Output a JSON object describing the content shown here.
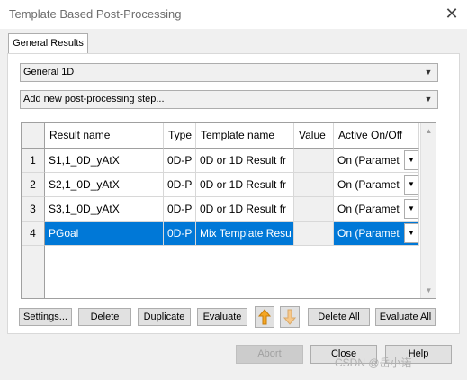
{
  "window": {
    "title": "Template Based Post-Processing"
  },
  "tabs": [
    {
      "label": "General Results"
    }
  ],
  "combo_general": {
    "value": "General 1D"
  },
  "combo_step": {
    "value": "Add new post-processing step..."
  },
  "grid": {
    "headers": [
      "Result name",
      "Type",
      "Template name",
      "Value",
      "Active On/Off"
    ],
    "rows": [
      {
        "index": "1",
        "name": "S1,1_0D_yAtX",
        "type": "0D-P",
        "template": "0D or 1D Result fr",
        "value": "",
        "active": "On (Paramet"
      },
      {
        "index": "2",
        "name": "S2,1_0D_yAtX",
        "type": "0D-P",
        "template": "0D or 1D Result fr",
        "value": "",
        "active": "On (Paramet"
      },
      {
        "index": "3",
        "name": "S3,1_0D_yAtX",
        "type": "0D-P",
        "template": "0D or 1D Result fr",
        "value": "",
        "active": "On (Paramet"
      },
      {
        "index": "4",
        "name": "PGoal",
        "type": "0D-P",
        "template": "Mix Template Resu",
        "value": "",
        "active": "On (Paramet"
      }
    ]
  },
  "actions": {
    "settings": "Settings...",
    "delete": "Delete",
    "duplicate": "Duplicate",
    "evaluate": "Evaluate",
    "delete_all": "Delete All",
    "evaluate_all": "Evaluate All"
  },
  "footer": {
    "abort": "Abort",
    "close": "Close",
    "help": "Help"
  },
  "watermark": "CSDN @岳小诺",
  "colors": {
    "selection": "#0078d7",
    "arrow_up": "#f5a623",
    "arrow_down": "#f7c98b"
  }
}
